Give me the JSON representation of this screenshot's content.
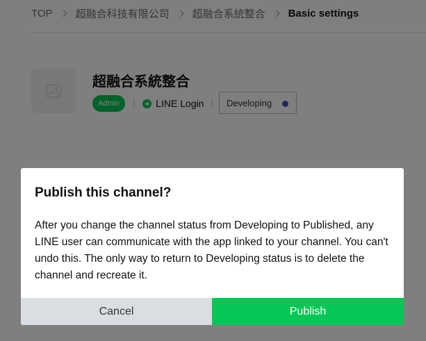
{
  "breadcrumb": {
    "items": [
      "TOP",
      "超融合科技有限公司",
      "超融合系統整合"
    ],
    "current": "Basic settings"
  },
  "channel": {
    "name": "超融合系統整合",
    "role_badge": "Admin",
    "type_label": "LINE Login",
    "status": "Developing"
  },
  "modal": {
    "title": "Publish this channel?",
    "body": "After you change the channel status from Developing to Published, any LINE user can communicate with the app linked to your channel. You can't undo this. The only way to return to Developing status is to delete the channel and recreate it.",
    "cancel_label": "Cancel",
    "publish_label": "Publish"
  },
  "colors": {
    "brand_green": "#06c755",
    "status_dot": "#3f51b5",
    "cancel_bg": "#dadde2"
  }
}
